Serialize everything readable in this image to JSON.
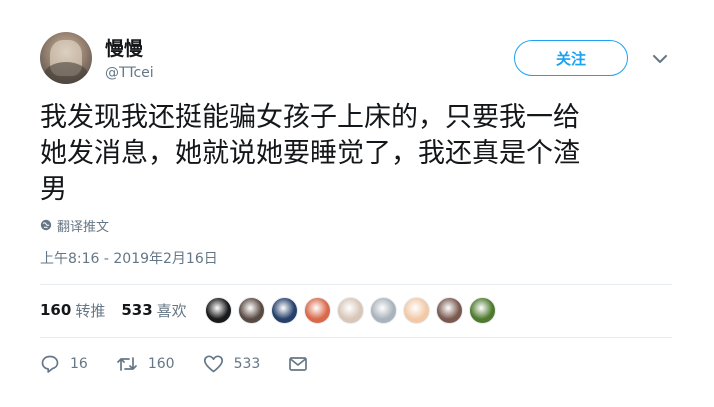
{
  "user": {
    "display_name": "慢慢",
    "handle": "@TTcei"
  },
  "follow_label": "关注",
  "tweet_text": "我发现我还挺能骗女孩子上床的，只要我一给\n她发消息，她就说她要睡觉了，我还真是个渣\n男",
  "translate_label": "翻译推文",
  "timestamp": "上午8:16 - 2019年2月16日",
  "stats": {
    "retweets_count": "160",
    "retweets_label": "转推",
    "likes_count": "533",
    "likes_label": "喜欢"
  },
  "liker_avatar_colors": [
    "#1a1a1a",
    "#5b4a44",
    "#27406a",
    "#d9694a",
    "#d8c6b8",
    "#aab3bb",
    "#f2c9a8",
    "#7a5a50",
    "#4f7a2e"
  ],
  "actions": {
    "reply_count": "16",
    "retweet_count": "160",
    "like_count": "533"
  },
  "colors": {
    "accent": "#1da1f2",
    "muted": "#657786",
    "divider": "#e6ecf0"
  },
  "icons": [
    "caret-down-icon",
    "globe-icon",
    "reply-icon",
    "retweet-icon",
    "heart-icon",
    "mail-icon"
  ]
}
